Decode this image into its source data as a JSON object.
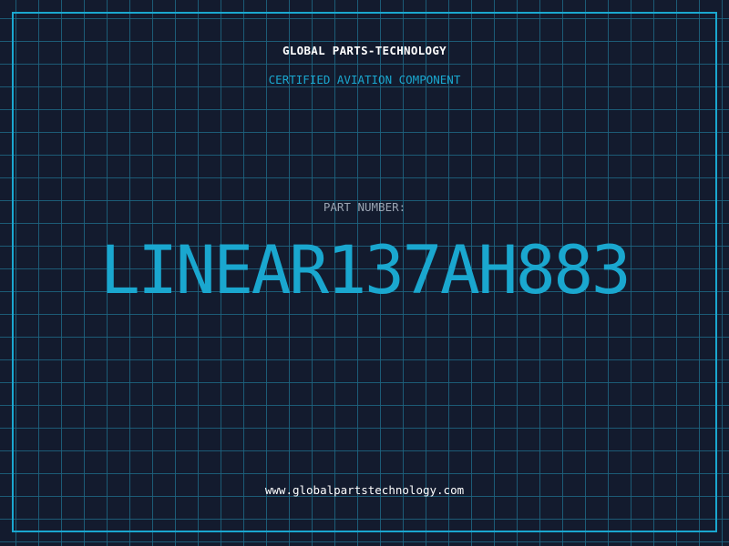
{
  "header": {
    "company": "GLOBAL PARTS-TECHNOLOGY",
    "subtitle": "CERTIFIED AVIATION COMPONENT"
  },
  "part": {
    "label": "PART NUMBER:",
    "number": "LINEAR137AH883"
  },
  "footer": {
    "website": "www.globalpartstechnology.com"
  },
  "colors": {
    "background": "#131b2e",
    "grid": "#1d6682",
    "accent": "#1aa7cf",
    "text": "#ffffff",
    "muted": "#9aa4b2"
  }
}
